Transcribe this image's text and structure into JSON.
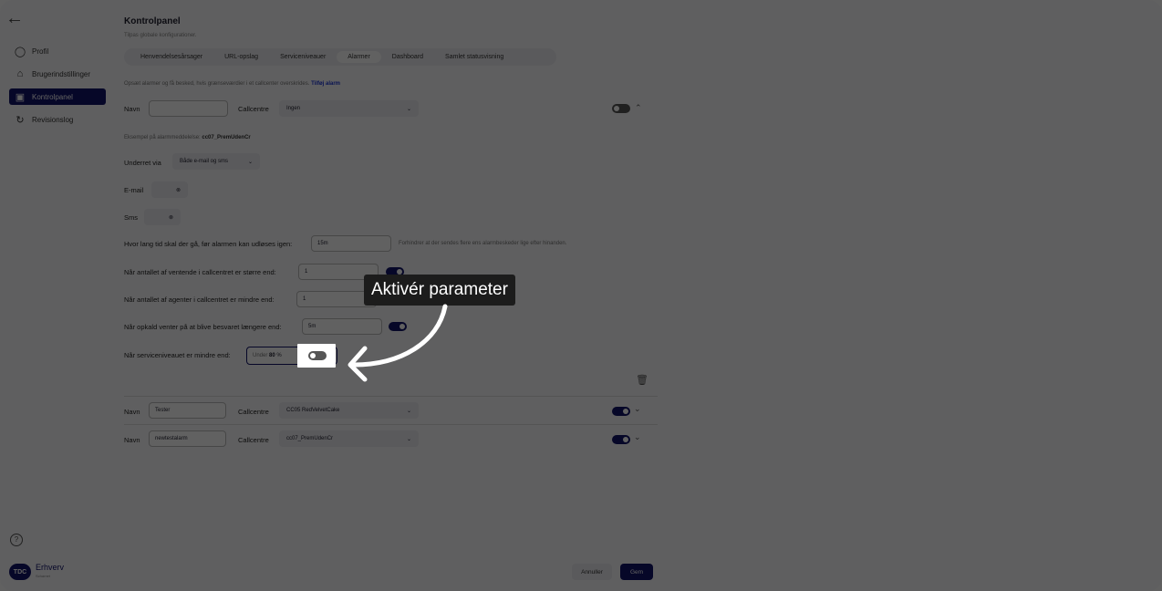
{
  "sidebar": {
    "items": [
      {
        "label": "Profil",
        "icon": "person-icon"
      },
      {
        "label": "Brugerindstillinger",
        "icon": "home-icon"
      },
      {
        "label": "Kontrolpanel",
        "icon": "panel-icon"
      },
      {
        "label": "Revisionslog",
        "icon": "refresh-icon"
      }
    ],
    "help": "?",
    "logo_badge": "TDC",
    "logo_text": "Erhverv",
    "logo_sub": "Scharnet"
  },
  "page": {
    "title": "Kontrolpanel",
    "subtitle": "Tilpas globale konfigurationer."
  },
  "tabs": [
    "Henvendelsesårsager",
    "URL-opslag",
    "Serviceniveauer",
    "Alarmer",
    "Dashboard",
    "Samlet statusvisning"
  ],
  "intro": {
    "text": "Opsæt alarmer og få besked, hvis grænseværdier i et callcenter overskrides. ",
    "link": "Tilføj alarm"
  },
  "alarm1": {
    "name_label": "Navn",
    "name_value": "",
    "cc_label": "Callcentre",
    "cc_value": "Ingen",
    "example_label": "Eksempel på alarmmeddelelse: ",
    "example_value": "cc07_PremUdenCr",
    "notify_label": "Underret via",
    "notify_value": "Både e-mail og sms",
    "email_label": "E-mail",
    "sms_label": "Sms",
    "cooldown_label": "Hvor lang tid skal der gå, før alarmen kan udløses igen:",
    "cooldown_value": "15m",
    "cooldown_hint": "Forhindrer at der sendes flere ens alarmbeskeder lige efter hinanden.",
    "waiting_label": "Når antallet af ventende i callcentret er større end:",
    "waiting_value": "1",
    "agents_label": "Når antallet af agenter i callcentret er mindre end:",
    "agents_value": "1",
    "wait_time_label": "Når opkald venter på at blive besvaret længere end:",
    "wait_time_value": "5m",
    "service_label": "Når serviceniveauet er mindre end:",
    "service_prefix": "Under",
    "service_value": "80",
    "service_unit": "%"
  },
  "alarm2": {
    "name_label": "Navn",
    "name_value": "Tester",
    "cc_label": "Callcentre",
    "cc_value": "CC05 RedVelvetCake"
  },
  "alarm3": {
    "name_label": "Navn",
    "name_value": "newtestalarm",
    "cc_label": "Callcentre",
    "cc_value": "cc07_PremUdenCr"
  },
  "footer": {
    "cancel": "Annuller",
    "save": "Gem"
  },
  "callout": {
    "text": "Aktivér parameter"
  },
  "colors": {
    "accent": "#12136a",
    "link": "#1a33d6"
  }
}
